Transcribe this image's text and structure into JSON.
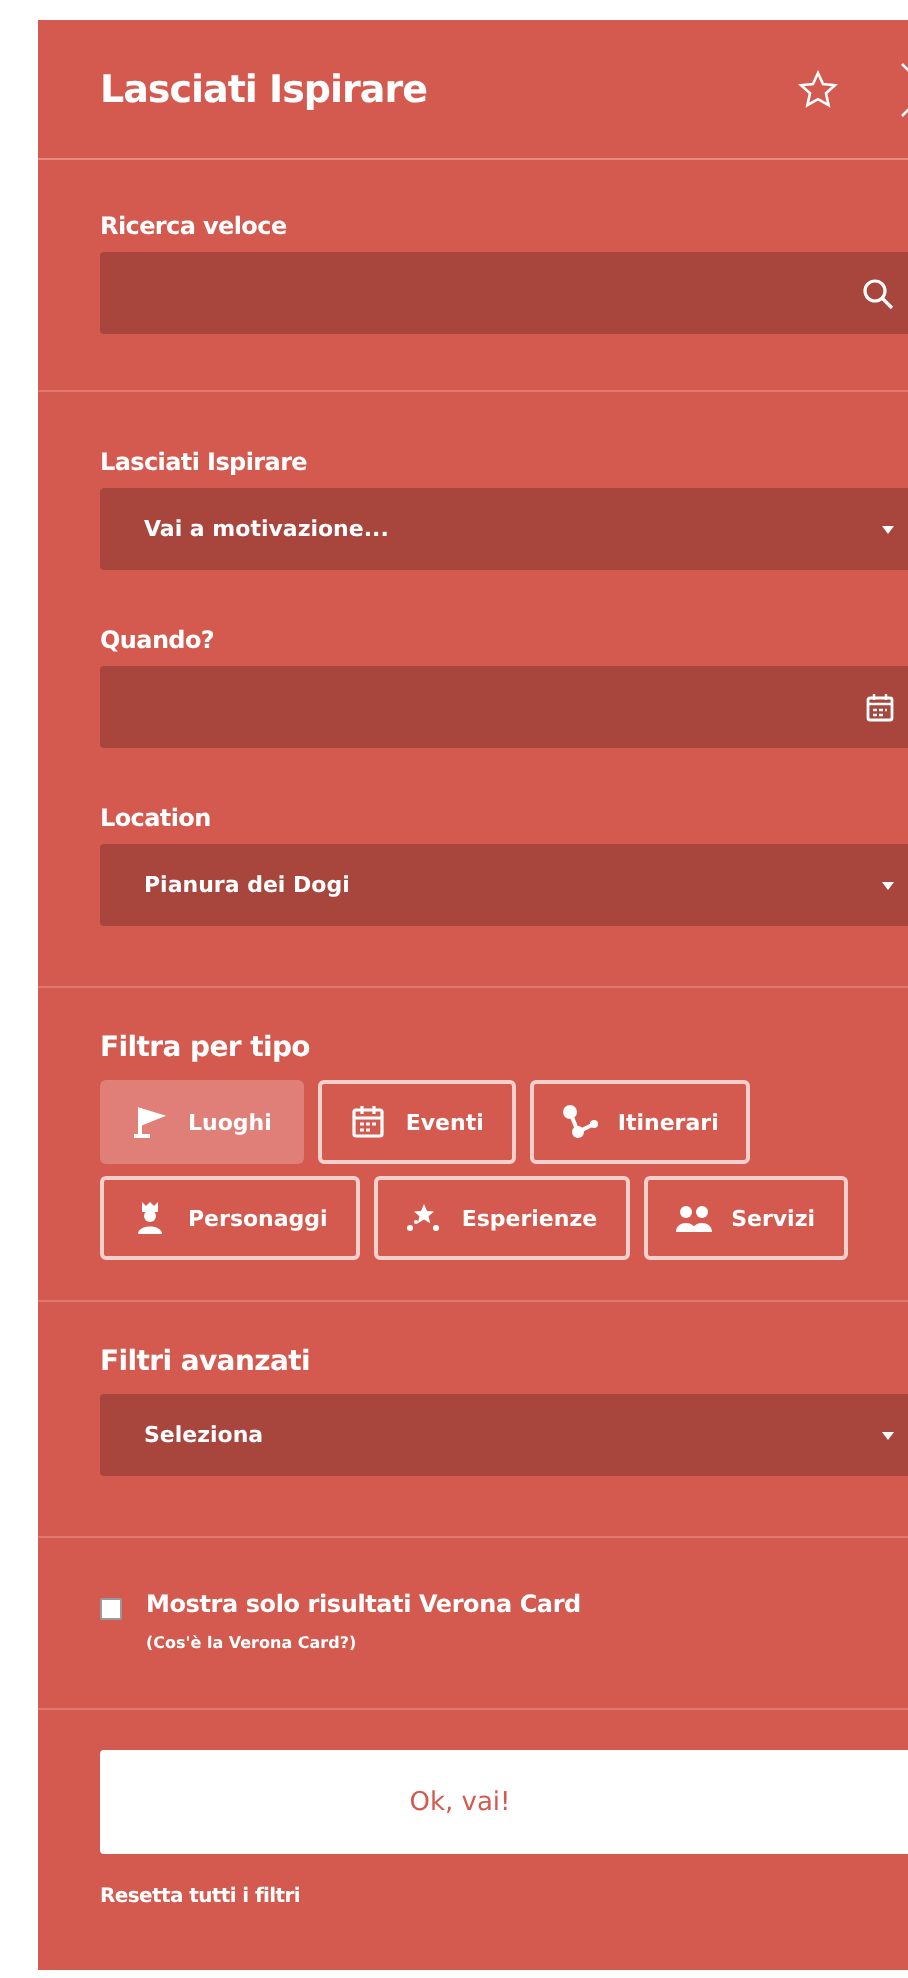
{
  "header": {
    "title": "Lasciati Ispirare"
  },
  "quick_search": {
    "label": "Ricerca veloce"
  },
  "inspire": {
    "label": "Lasciati Ispirare",
    "value": "Vai a motivazione..."
  },
  "when": {
    "label": "Quando?"
  },
  "location": {
    "label": "Location",
    "value": "Pianura dei Dogi"
  },
  "filter_type": {
    "title": "Filtra per tipo",
    "items": [
      {
        "kind": "flag",
        "label": "Luoghi",
        "selected": true
      },
      {
        "kind": "calendar",
        "label": "Eventi",
        "selected": false
      },
      {
        "kind": "route",
        "label": "Itinerari",
        "selected": false
      },
      {
        "kind": "person",
        "label": "Personaggi",
        "selected": false
      },
      {
        "kind": "stars",
        "label": "Esperienze",
        "selected": false
      },
      {
        "kind": "people",
        "label": "Servizi",
        "selected": false
      }
    ]
  },
  "advanced": {
    "title": "Filtri avanzati",
    "value": "Seleziona"
  },
  "verona_card": {
    "label": "Mostra solo risultati Verona Card",
    "link": "(Cos'è la Verona Card?)",
    "checked": false
  },
  "submit": {
    "label": "Ok, vai!"
  },
  "reset": {
    "label": "Resetta tutti i filtri"
  }
}
